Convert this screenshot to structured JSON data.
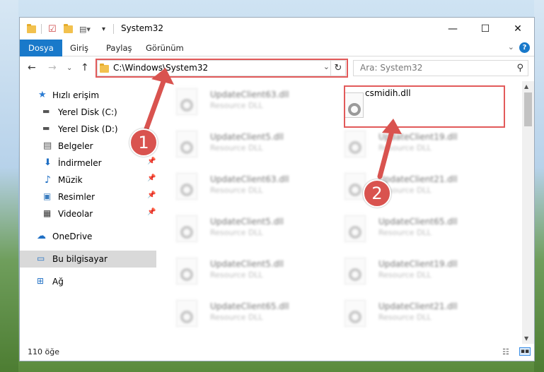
{
  "window": {
    "title": "System32",
    "minimize": "—",
    "maximize": "☐",
    "close": "✕"
  },
  "ribbon": {
    "tabs": [
      "Dosya",
      "Giriş",
      "Paylaş",
      "Görünüm"
    ],
    "help": "?"
  },
  "address": {
    "path": "C:\\Windows\\System32",
    "search_placeholder": "Ara: System32"
  },
  "sidebar": {
    "items": [
      {
        "label": "Hızlı erişim",
        "icon": "star-icon"
      },
      {
        "label": "Yerel Disk (C:)",
        "icon": "drive-icon"
      },
      {
        "label": "Yerel Disk (D:)",
        "icon": "drive-icon"
      },
      {
        "label": "Belgeler",
        "icon": "document-icon"
      },
      {
        "label": "İndirmeler",
        "icon": "download-icon",
        "pinned": true
      },
      {
        "label": "Müzik",
        "icon": "music-icon",
        "pinned": true
      },
      {
        "label": "Resimler",
        "icon": "picture-icon",
        "pinned": true
      },
      {
        "label": "Videolar",
        "icon": "video-icon",
        "pinned": true
      },
      {
        "label": "OneDrive",
        "icon": "cloud-icon"
      },
      {
        "label": "Bu bilgisayar",
        "icon": "computer-icon",
        "selected": true
      },
      {
        "label": "Ağ",
        "icon": "network-icon"
      }
    ]
  },
  "files": {
    "highlighted": {
      "name": "csmidih.dll"
    },
    "left": [
      {
        "name": "UpdateClient63.dll",
        "type": "Resource DLL"
      },
      {
        "name": "UpdateClient5.dll",
        "type": "Resource DLL"
      },
      {
        "name": "UpdateClient63.dll",
        "type": "Resource DLL"
      },
      {
        "name": "UpdateClient5.dll",
        "type": "Resource DLL"
      },
      {
        "name": "UpdateClient5.dll",
        "type": "Resource DLL"
      },
      {
        "name": "UpdateClient65.dll",
        "type": "Resource DLL"
      }
    ],
    "right": [
      {
        "name": "UpdateClient19.dll",
        "type": "Resource DLL"
      },
      {
        "name": "UpdateClient21.dll",
        "type": "Resource DLL"
      },
      {
        "name": "UpdateClient65.dll",
        "type": "Resource DLL"
      },
      {
        "name": "UpdateClient19.dll",
        "type": "Resource DLL"
      },
      {
        "name": "UpdateClient21.dll",
        "type": "Resource DLL"
      }
    ]
  },
  "status": {
    "item_count": "110 öğe"
  },
  "markers": [
    "1",
    "2"
  ],
  "colors": {
    "accent": "#1979ca",
    "highlight": "#e25a5a",
    "marker": "#d9534f"
  }
}
